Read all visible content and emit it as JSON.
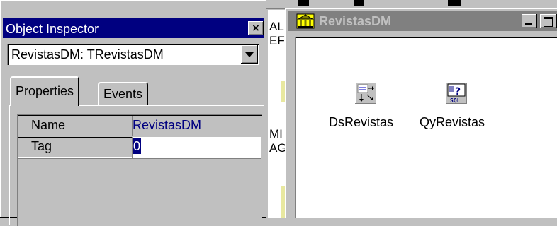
{
  "inspector": {
    "title": "Object Inspector",
    "close_glyph": "×",
    "selected_object": "RevistasDM: TRevistasDM",
    "tabs": [
      "Properties",
      "Events"
    ],
    "properties": [
      {
        "name": "Name",
        "value": "RevistasDM"
      },
      {
        "name": "Tag",
        "value": "0"
      }
    ]
  },
  "background_window": {
    "fragments": [
      "AL",
      "EF",
      "MI",
      "AG"
    ]
  },
  "data_module": {
    "title": "RevistasDM",
    "components": [
      {
        "label": "DsRevistas",
        "icon": "datasource-icon"
      },
      {
        "label": "QyRevistas",
        "icon": "sql-query-icon"
      }
    ],
    "sql_icon_text": "SQL",
    "sql_icon_mark": "?"
  },
  "colors": {
    "active_title": "#000080",
    "inactive_title": "#808080",
    "face": "#c0c0c0",
    "value_text": "#000080"
  }
}
